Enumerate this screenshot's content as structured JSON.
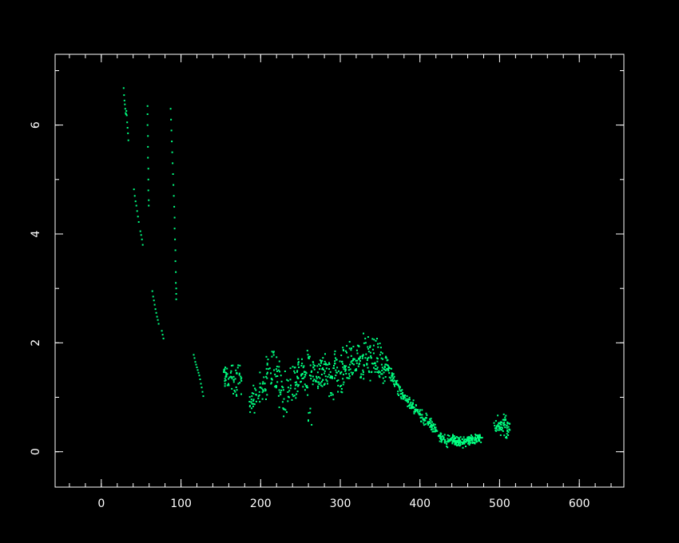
{
  "chart_data": {
    "type": "scatter",
    "title": "",
    "xlabel": "",
    "ylabel": "",
    "xlim": [
      -58,
      656
    ],
    "ylim": [
      -0.65,
      7.3
    ],
    "x_ticks": [
      0,
      100,
      200,
      300,
      400,
      500,
      600
    ],
    "x_tick_labels": [
      "0",
      "100",
      "200",
      "300",
      "400",
      "500",
      "600"
    ],
    "y_ticks": [
      0,
      2,
      4,
      6
    ],
    "y_tick_labels": [
      "0",
      "2",
      "4",
      "6"
    ],
    "x_minor_step": 20,
    "y_minor_step": 1,
    "grid": false,
    "colors": {
      "background": "#000000",
      "axes": "#ffffff",
      "points": "#00ff80"
    },
    "series": [
      {
        "points": [
          [
            28,
            6.68
          ],
          [
            28.5,
            6.55
          ],
          [
            29,
            6.45
          ],
          [
            29.5,
            6.38
          ],
          [
            30,
            6.3
          ],
          [
            30.5,
            6.22
          ],
          [
            31,
            6.2
          ],
          [
            31.5,
            6.26
          ],
          [
            32,
            6.18
          ],
          [
            32.5,
            6.05
          ],
          [
            33,
            5.95
          ],
          [
            33.5,
            5.85
          ],
          [
            34,
            5.72
          ],
          [
            41,
            4.82
          ],
          [
            42,
            4.7
          ],
          [
            43,
            4.6
          ],
          [
            44,
            4.52
          ],
          [
            45,
            4.42
          ],
          [
            46,
            4.32
          ],
          [
            47,
            4.22
          ],
          [
            49,
            4.05
          ],
          [
            50,
            3.98
          ],
          [
            51,
            3.9
          ],
          [
            52,
            3.8
          ],
          [
            58,
            6.35
          ],
          [
            58,
            6.2
          ],
          [
            58,
            6.0
          ],
          [
            58.5,
            5.8
          ],
          [
            58.5,
            5.6
          ],
          [
            58.5,
            5.4
          ],
          [
            59,
            5.2
          ],
          [
            59,
            5.0
          ],
          [
            59,
            4.8
          ],
          [
            59.5,
            4.62
          ],
          [
            59.5,
            4.52
          ],
          [
            64,
            2.95
          ],
          [
            65,
            2.85
          ],
          [
            66,
            2.78
          ],
          [
            67,
            2.7
          ],
          [
            68,
            2.62
          ],
          [
            69,
            2.55
          ],
          [
            70,
            2.48
          ],
          [
            71,
            2.42
          ],
          [
            72,
            2.35
          ],
          [
            76,
            2.22
          ],
          [
            77,
            2.15
          ],
          [
            78,
            2.08
          ],
          [
            87,
            6.3
          ],
          [
            87.5,
            6.1
          ],
          [
            88,
            5.9
          ],
          [
            88.5,
            5.7
          ],
          [
            89,
            5.5
          ],
          [
            89.5,
            5.3
          ],
          [
            90,
            5.1
          ],
          [
            90.5,
            4.9
          ],
          [
            91,
            4.7
          ],
          [
            91.5,
            4.5
          ],
          [
            92,
            4.3
          ],
          [
            92,
            4.1
          ],
          [
            92.5,
            3.9
          ],
          [
            93,
            3.7
          ],
          [
            93,
            3.5
          ],
          [
            93.5,
            3.3
          ],
          [
            93.5,
            3.1
          ],
          [
            94,
            3.0
          ],
          [
            94,
            2.9
          ],
          [
            94,
            2.8
          ],
          [
            116,
            1.78
          ],
          [
            117,
            1.72
          ],
          [
            118,
            1.65
          ],
          [
            119,
            1.6
          ],
          [
            120,
            1.55
          ],
          [
            121,
            1.5
          ],
          [
            122,
            1.45
          ],
          [
            123,
            1.4
          ],
          [
            124,
            1.33
          ],
          [
            125,
            1.25
          ],
          [
            126,
            1.18
          ],
          [
            127,
            1.1
          ],
          [
            128,
            1.02
          ]
        ],
        "noise": [
          0,
          0
        ]
      },
      {
        "points": [
          [
            155,
            1.3
          ],
          [
            155,
            1.52
          ],
          [
            157,
            1.38
          ],
          [
            160,
            1.22
          ],
          [
            163,
            1.48
          ],
          [
            166,
            1.32
          ],
          [
            168,
            1.1
          ],
          [
            170,
            1.45
          ],
          [
            172,
            1.25
          ],
          [
            175,
            1.38
          ],
          [
            186,
            0.92
          ],
          [
            189,
            1.02
          ],
          [
            191,
            0.88
          ],
          [
            194,
            1.05
          ],
          [
            197,
            0.98
          ],
          [
            200,
            1.18
          ],
          [
            203,
            1.28
          ],
          [
            206,
            1.12
          ],
          [
            208,
            1.35
          ],
          [
            210,
            1.52
          ],
          [
            213,
            1.25
          ],
          [
            216,
            1.82
          ],
          [
            218,
            1.42
          ],
          [
            221,
            1.28
          ],
          [
            223,
            1.56
          ],
          [
            225,
            1.05
          ],
          [
            228,
            1.18
          ],
          [
            230,
            0.78
          ],
          [
            233,
            1.32
          ],
          [
            236,
            1.12
          ],
          [
            240,
            1.05
          ],
          [
            242,
            1.48
          ],
          [
            244,
            1.22
          ],
          [
            246,
            1.38
          ],
          [
            248,
            1.55
          ],
          [
            250,
            1.28
          ],
          [
            252,
            1.62
          ],
          [
            254,
            1.35
          ],
          [
            256,
            1.42
          ],
          [
            258,
            1.18
          ],
          [
            260,
            1.72
          ],
          [
            262,
            0.72
          ],
          [
            264,
            1.48
          ],
          [
            266,
            1.3
          ],
          [
            268,
            1.58
          ],
          [
            270,
            1.38
          ],
          [
            272,
            1.2
          ],
          [
            274,
            1.52
          ],
          [
            276,
            1.66
          ],
          [
            278,
            1.32
          ],
          [
            280,
            1.44
          ],
          [
            282,
            1.62
          ],
          [
            284,
            1.25
          ],
          [
            286,
            1.52
          ],
          [
            288,
            1.08
          ],
          [
            290,
            1.38
          ],
          [
            292,
            1.58
          ],
          [
            294,
            1.72
          ],
          [
            296,
            1.3
          ],
          [
            298,
            1.48
          ],
          [
            300,
            1.2
          ],
          [
            302,
            1.65
          ],
          [
            304,
            1.42
          ],
          [
            306,
            1.55
          ],
          [
            308,
            1.82
          ],
          [
            310,
            1.35
          ],
          [
            312,
            1.6
          ],
          [
            314,
            1.9
          ],
          [
            316,
            1.45
          ],
          [
            318,
            1.7
          ],
          [
            320,
            1.52
          ],
          [
            322,
            1.95
          ],
          [
            324,
            1.62
          ],
          [
            326,
            1.38
          ],
          [
            328,
            1.75
          ],
          [
            330,
            1.58
          ],
          [
            332,
            2.0
          ],
          [
            334,
            1.68
          ],
          [
            336,
            1.48
          ],
          [
            338,
            1.82
          ],
          [
            340,
            1.62
          ],
          [
            342,
            1.95
          ],
          [
            344,
            1.52
          ],
          [
            346,
            1.72
          ],
          [
            348,
            1.45
          ],
          [
            350,
            1.78
          ],
          [
            352,
            1.6
          ],
          [
            354,
            1.35
          ],
          [
            356,
            1.55
          ],
          [
            358,
            1.72
          ]
        ],
        "noise": [
          6,
          0.28
        ],
        "copies": 6
      },
      {
        "points": [
          [
            360,
            1.5
          ],
          [
            365,
            1.38
          ],
          [
            370,
            1.25
          ],
          [
            375,
            1.12
          ],
          [
            380,
            1.02
          ],
          [
            385,
            0.92
          ],
          [
            390,
            0.85
          ],
          [
            395,
            0.76
          ],
          [
            400,
            0.7
          ],
          [
            405,
            0.6
          ],
          [
            410,
            0.55
          ],
          [
            415,
            0.45
          ],
          [
            420,
            0.38
          ],
          [
            425,
            0.3
          ],
          [
            430,
            0.25
          ],
          [
            435,
            0.2
          ]
        ],
        "noise": [
          6,
          0.14
        ],
        "copies": 14
      },
      {
        "points": [
          [
            440,
            0.22
          ],
          [
            445,
            0.2
          ],
          [
            450,
            0.2
          ],
          [
            455,
            0.19
          ],
          [
            460,
            0.2
          ],
          [
            465,
            0.22
          ],
          [
            470,
            0.24
          ],
          [
            474,
            0.25
          ]
        ],
        "noise": [
          6,
          0.14
        ],
        "copies": 22
      },
      {
        "points": [
          [
            496,
            0.45
          ],
          [
            500,
            0.52
          ],
          [
            503,
            0.4
          ],
          [
            506,
            0.58
          ],
          [
            509,
            0.48
          ],
          [
            511,
            0.36
          ]
        ],
        "noise": [
          5,
          0.2
        ],
        "copies": 12
      }
    ]
  }
}
